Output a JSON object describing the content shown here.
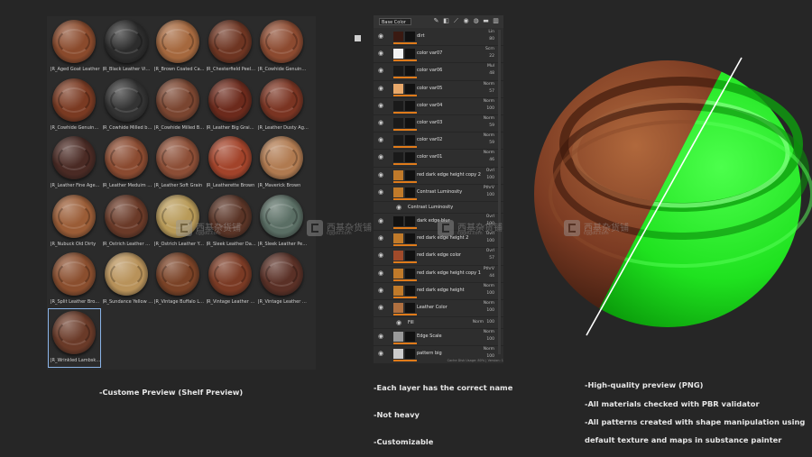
{
  "shelf": {
    "materials": [
      {
        "label": "JR_Aged Goat Leather",
        "color": "#8a4a2c",
        "selected": false
      },
      {
        "label": "JR_Black Leather Vint...",
        "color": "#2c2c2c",
        "selected": false
      },
      {
        "label": "JR_Brown Coated Ca...",
        "color": "#a5683e",
        "selected": false
      },
      {
        "label": "JR_Chesterfield Peelin...",
        "color": "#6e3522",
        "selected": false
      },
      {
        "label": "JR_Cowhide Genuine ...",
        "color": "#8c4a30",
        "selected": false
      },
      {
        "label": "JR_Cowhide Genuine ...",
        "color": "#7a3a22",
        "selected": false
      },
      {
        "label": "JR_Cowhide Milled bl...",
        "color": "#333333",
        "selected": false
      },
      {
        "label": "JR_Cowhide Milled Br...",
        "color": "#7a4530",
        "selected": false
      },
      {
        "label": "JR_Leather Big Grain ...",
        "color": "#6c2a1c",
        "selected": false
      },
      {
        "label": "JR_Leather Dusty Aged",
        "color": "#7a3422",
        "selected": false
      },
      {
        "label": "JR_Leather Fine Aged ...",
        "color": "#4a2a24",
        "selected": false
      },
      {
        "label": "JR_Leather Meduim G...",
        "color": "#8a4a30",
        "selected": false
      },
      {
        "label": "JR_Leather Soft Grain",
        "color": "#8c4e36",
        "selected": false
      },
      {
        "label": "JR_Leatherette Brown",
        "color": "#a2432a",
        "selected": false
      },
      {
        "label": "JR_Maverick Brown",
        "color": "#b07a50",
        "selected": false
      },
      {
        "label": "JR_Nubuck Old Dirty",
        "color": "#9a5c36",
        "selected": false
      },
      {
        "label": "JR_Ostrich Leather Br...",
        "color": "#6a3a28",
        "selected": false
      },
      {
        "label": "JR_Ostrich Leather Yel...",
        "color": "#b89a58",
        "selected": false
      },
      {
        "label": "JR_Sleek Leather Dark...",
        "color": "#5a3426",
        "selected": false
      },
      {
        "label": "JR_Sleek Leather Pewter",
        "color": "#5a6e64",
        "selected": false
      },
      {
        "label": "JR_Split Leather Brown",
        "color": "#8a4e2e",
        "selected": false
      },
      {
        "label": "JR_Sundance Yellow L...",
        "color": "#b8925a",
        "selected": false
      },
      {
        "label": "JR_Vintage Buffalo Le...",
        "color": "#7a4226",
        "selected": false
      },
      {
        "label": "JR_Vintage Leather D...",
        "color": "#7a3a24",
        "selected": false
      },
      {
        "label": "JR_Vintage Leather D...",
        "color": "#5a3026",
        "selected": false
      },
      {
        "label": "JR_Wrinkled Lambski...",
        "color": "#6a3a28",
        "selected": true
      }
    ]
  },
  "layers": {
    "channel": "Base Color",
    "toolbar_icons": [
      "brush-icon",
      "fill-icon",
      "smart-mask-icon",
      "paint-icon",
      "palette-icon",
      "folder-icon",
      "trash-icon"
    ],
    "rows": [
      {
        "name": "dirt",
        "blend": "Lin",
        "opacity": "80",
        "thumb": "#3a1a12",
        "sub": false
      },
      {
        "name": "color var07",
        "blend": "Scrn",
        "opacity": "22",
        "thumb": "#f2f2f2",
        "sub": false
      },
      {
        "name": "color var06",
        "blend": "Mul",
        "opacity": "48",
        "thumb": "#1a1a1a",
        "sub": false
      },
      {
        "name": "color var05",
        "blend": "Norm",
        "opacity": "57",
        "thumb": "#e8a86a",
        "sub": false
      },
      {
        "name": "color var04",
        "blend": "Norm",
        "opacity": "100",
        "thumb": "#1a1a1a",
        "sub": false
      },
      {
        "name": "color var03",
        "blend": "Norm",
        "opacity": "59",
        "thumb": "#1a1a1a",
        "sub": false
      },
      {
        "name": "color var02",
        "blend": "Norm",
        "opacity": "59",
        "thumb": "#1a1a1a",
        "sub": false
      },
      {
        "name": "color var01",
        "blend": "Norm",
        "opacity": "46",
        "thumb": "#1a1a1a",
        "sub": false
      },
      {
        "name": "red dark edge height copy 2",
        "blend": "Ovrl",
        "opacity": "100",
        "thumb": "#c07a2a",
        "sub": false
      },
      {
        "name": "Contrast Luminosity",
        "blend": "PthrV",
        "opacity": "100",
        "thumb": "#c07a2a",
        "sub": false
      },
      {
        "name": "Contrast Luminosity",
        "blend": "",
        "opacity": "",
        "thumb": "",
        "sub": true
      },
      {
        "name": "dark edge blur",
        "blend": "Ovrl",
        "opacity": "100",
        "thumb": "#111111",
        "sub": false
      },
      {
        "name": "red dark edge height 2",
        "blend": "Ovrl",
        "opacity": "100",
        "thumb": "#c07a2a",
        "sub": false
      },
      {
        "name": "red dark edge color",
        "blend": "Ovrl",
        "opacity": "57",
        "thumb": "#a04a2a",
        "sub": false
      },
      {
        "name": "red dark edge height copy 1",
        "blend": "PthrV",
        "opacity": "44",
        "thumb": "#c07a2a",
        "sub": false
      },
      {
        "name": "red dark edge height",
        "blend": "Norm",
        "opacity": "100",
        "thumb": "#c07a2a",
        "sub": false
      },
      {
        "name": "Leather Color",
        "blend": "Norm",
        "opacity": "100",
        "thumb": "#b07040",
        "sub": false
      },
      {
        "name": "Fill",
        "blend": "Norm",
        "opacity": "100",
        "thumb": "",
        "sub": true
      },
      {
        "name": "Edge Scale",
        "blend": "Norm",
        "opacity": "100",
        "thumb": "#9a9a9a",
        "sub": false
      },
      {
        "name": "pattern big",
        "blend": "Norm",
        "opacity": "100",
        "thumb": "#cccccc",
        "sub": false
      }
    ],
    "status": "Cache Disk Usage: 80% | Version: 1"
  },
  "preview": {
    "leather_color": "#7a3a22",
    "mask_color": "#1fe21f"
  },
  "captions": {
    "shelf": "-Custome Preview (Shelf Preview)",
    "layers": [
      "-Each layer has the correct name",
      "-Not heavy",
      "-Customizable"
    ],
    "preview": [
      "-High-quality preview (PNG)",
      "-All materials checked with PBR validator",
      "-All patterns created with shape manipulation using",
      "default texture and maps in substance painter"
    ]
  },
  "watermark": {
    "title": "西基杂货铺",
    "url": "cggou.com"
  }
}
